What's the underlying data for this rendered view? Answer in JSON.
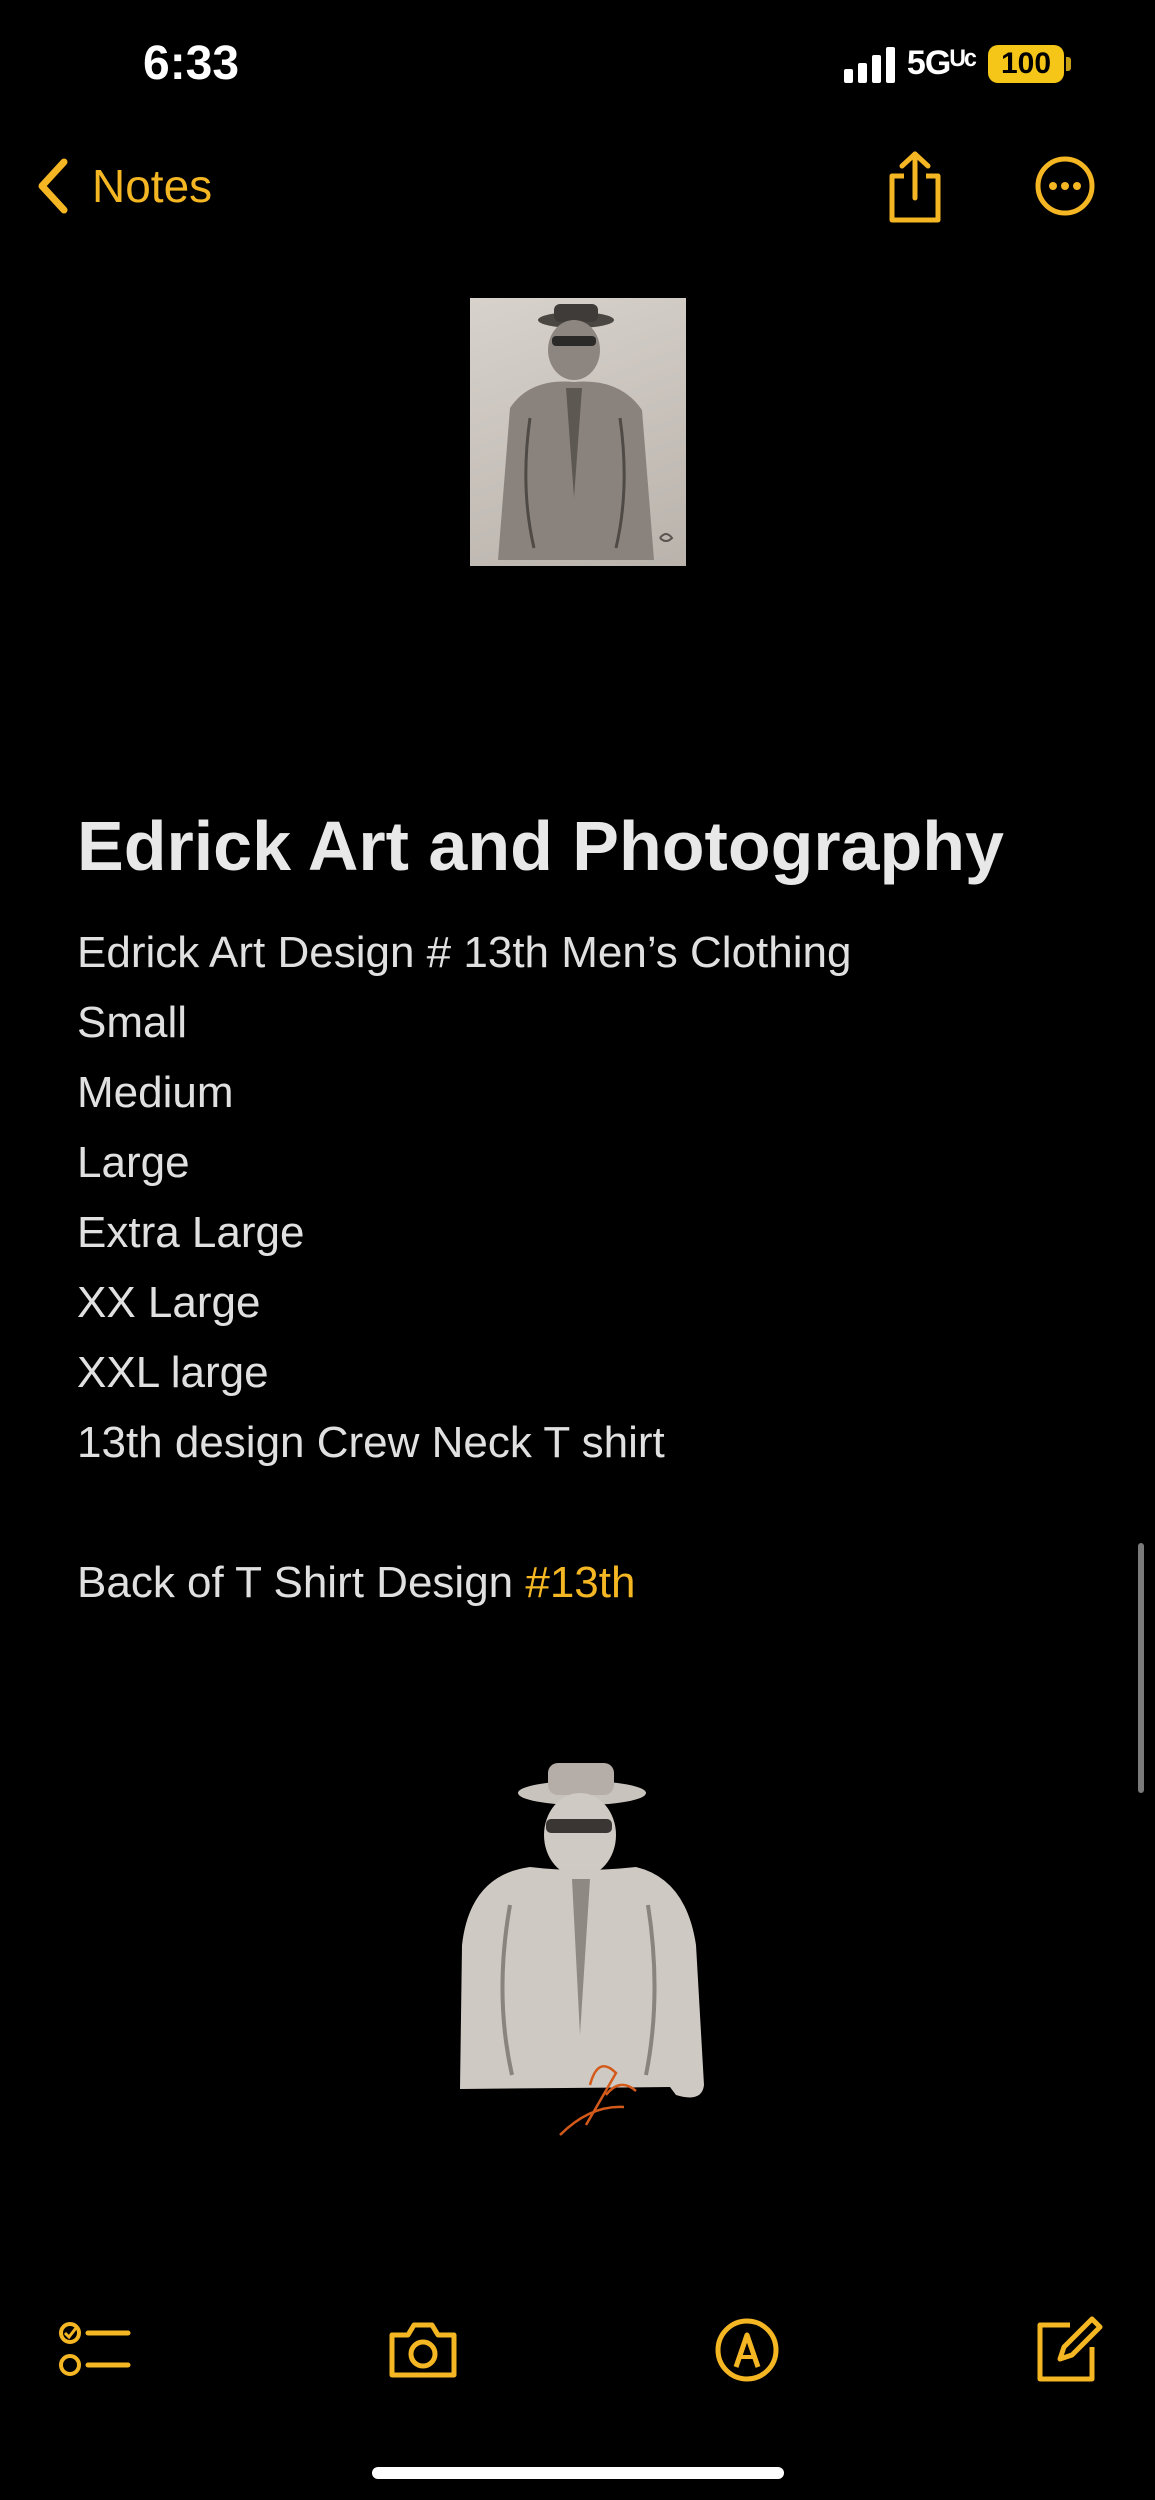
{
  "status_bar": {
    "time": "6:33",
    "network": "5Gᵁᶜ",
    "battery": "100",
    "battery_color": "#f5c518"
  },
  "nav": {
    "back_label": "Notes",
    "accent_color": "#f5b623",
    "icons": [
      "chevron-left-icon",
      "share-icon",
      "more-icon"
    ]
  },
  "note": {
    "title": "Edrick Art and Photography",
    "lines": [
      "Edrick Art Design # 13th Men’s Clothing",
      "Small",
      "Medium",
      "Large",
      "Extra Large",
      "XX Large",
      "XXL large",
      "13th design Crew Neck T shirt"
    ],
    "back_line_text": "Back of T Shirt Design ",
    "back_line_hashtag": "#13th"
  },
  "images": {
    "top": "pencil drawing of man in hat and coat",
    "bottom": "cutout pencil drawing of man in hat and coat with signature"
  },
  "toolbar": {
    "icons": [
      "checklist-icon",
      "camera-icon",
      "markup-icon",
      "compose-icon"
    ]
  }
}
